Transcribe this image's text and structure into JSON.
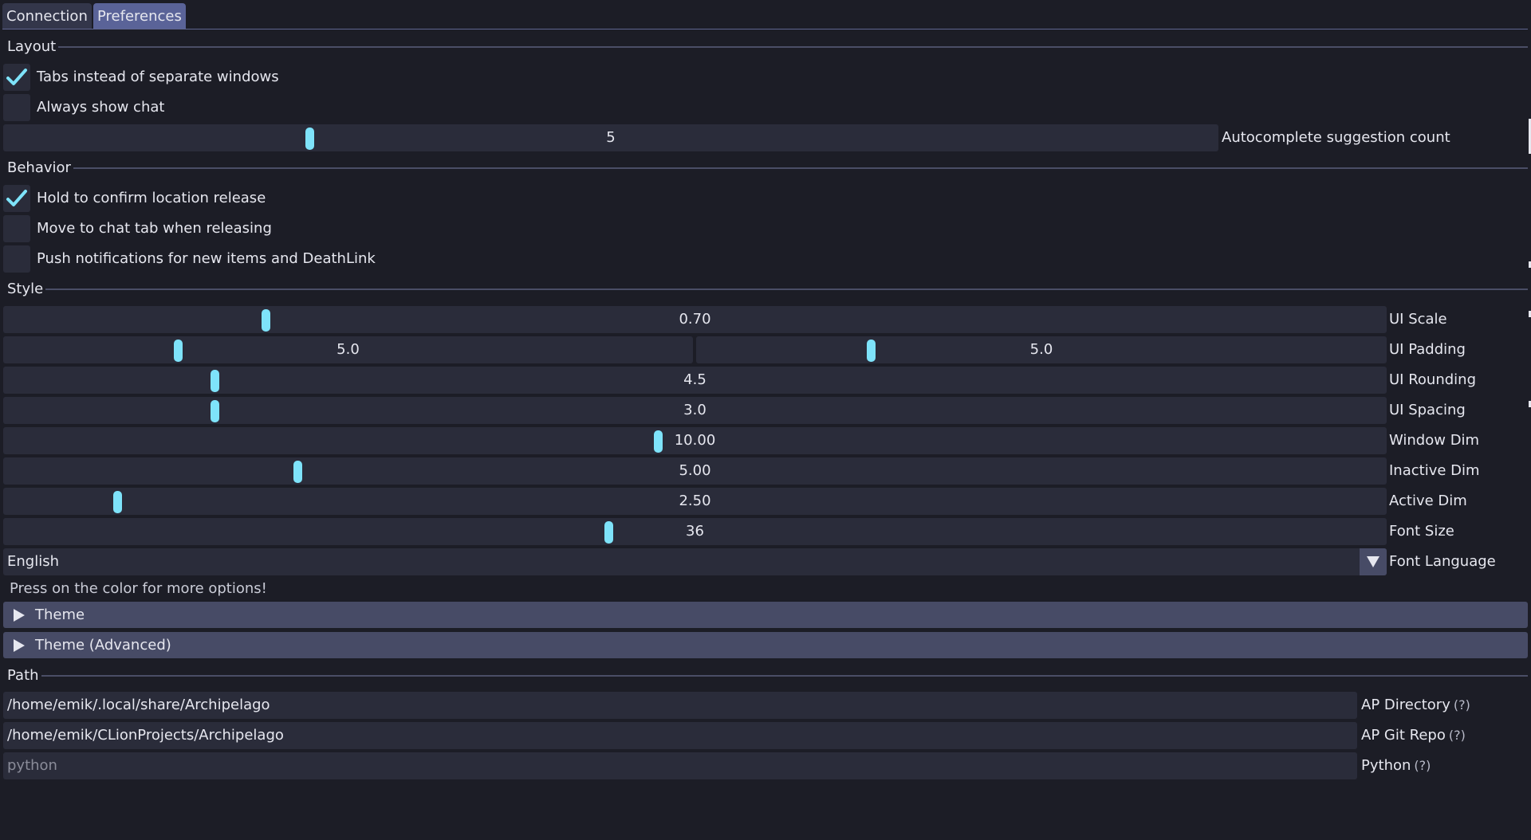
{
  "tabs": [
    {
      "label": "Connection",
      "active": false
    },
    {
      "label": "Preferences",
      "active": true
    }
  ],
  "sections": {
    "layout": "Layout",
    "behavior": "Behavior",
    "style": "Style",
    "path": "Path"
  },
  "layout": {
    "tabs_instead": {
      "label": "Tabs instead of separate windows",
      "checked": true
    },
    "always_chat": {
      "label": "Always show chat",
      "checked": false
    },
    "autocomplete": {
      "label": "Autocomplete suggestion count",
      "value": "5"
    }
  },
  "behavior": {
    "hold_confirm": {
      "label": "Hold to confirm location release",
      "checked": true
    },
    "move_chat": {
      "label": "Move to chat tab when releasing",
      "checked": false
    },
    "push_notif": {
      "label": "Push notifications for new items and DeathLink",
      "checked": false
    }
  },
  "style": {
    "ui_scale": {
      "label": "UI Scale",
      "value": "0.70"
    },
    "ui_padding": {
      "label": "UI Padding",
      "value_x": "5.0",
      "value_y": "5.0"
    },
    "ui_rounding": {
      "label": "UI Rounding",
      "value": "4.5"
    },
    "ui_spacing": {
      "label": "UI Spacing",
      "value": "3.0"
    },
    "window_dim": {
      "label": "Window Dim",
      "value": "10.00"
    },
    "inactive_dim": {
      "label": "Inactive Dim",
      "value": "5.00"
    },
    "active_dim": {
      "label": "Active Dim",
      "value": "2.50"
    },
    "font_size": {
      "label": "Font Size",
      "value": "36"
    },
    "font_language": {
      "label": "Font Language",
      "value": "English"
    },
    "hint": "Press on the color for more options!",
    "theme": "Theme",
    "theme_advanced": "Theme (Advanced)"
  },
  "path": {
    "ap_directory": {
      "label": "AP Directory",
      "value": "/home/emik/.local/share/Archipelago",
      "help": "(?)"
    },
    "ap_git_repo": {
      "label": "AP Git Repo",
      "value": "/home/emik/CLionProjects/Archipelago",
      "help": "(?)"
    },
    "python": {
      "label": "Python",
      "placeholder": "python",
      "help": "(?)"
    }
  },
  "colors": {
    "background": "#1c1d26",
    "frame": "#2a2c3a",
    "accent": "#7ee3fa",
    "active_tab": "#5a6398",
    "header": "#474b66"
  }
}
